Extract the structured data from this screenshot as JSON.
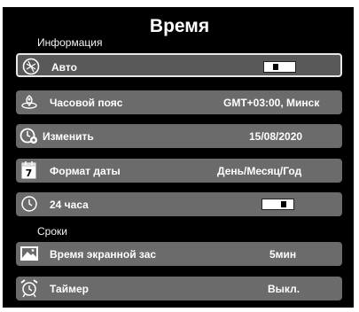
{
  "title": "Время",
  "sections": {
    "info": "Информация",
    "terms": "Сроки"
  },
  "settings": [
    {
      "label": "Авто",
      "icon": "auto-sync-icon",
      "type": "toggle",
      "state": "off"
    },
    {
      "label": "Часовой пояс",
      "icon": "location-pin-icon",
      "value": "GMT+03:00, Минск"
    },
    {
      "label": "Изменить",
      "icon": "clock-settings-icon",
      "value": "15/08/2020"
    },
    {
      "label": "Формат даты",
      "icon": "calendar-icon",
      "value": "День/Месяц/Год"
    },
    {
      "label": "24 часа",
      "icon": "clock-icon",
      "type": "toggle",
      "state": "on"
    },
    {
      "label": "Время экранной зас",
      "icon": "screen-image-icon",
      "value": "5мин"
    },
    {
      "label": "Таймер",
      "icon": "alarm-clock-icon",
      "value": "Выкл."
    }
  ],
  "calendar_icon_digit": "7",
  "colors": {
    "background": "#000000",
    "row": "#6b6b6b",
    "selected_border": "#e6e6e6",
    "text": "#ffffff"
  }
}
